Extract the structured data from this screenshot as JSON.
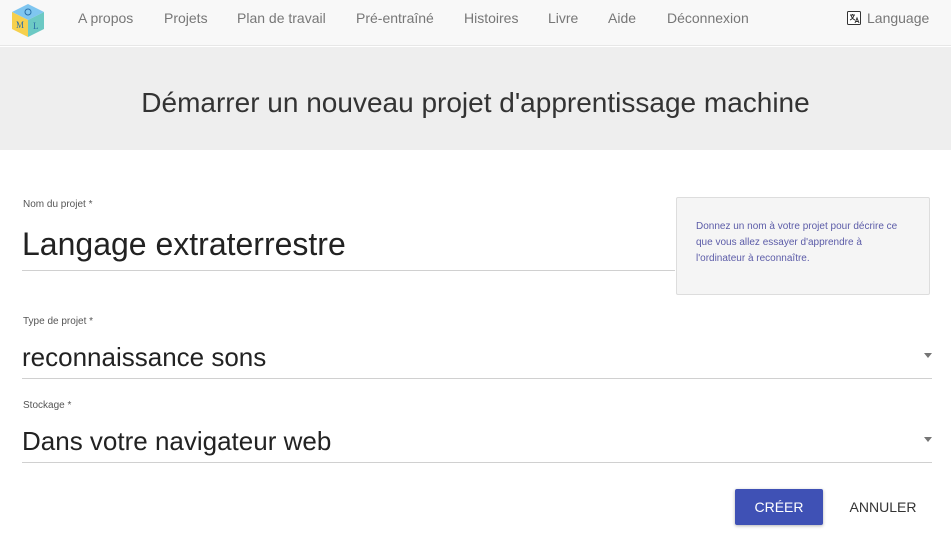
{
  "nav": {
    "items": [
      "A propos",
      "Projets",
      "Plan de travail",
      "Pré-entraîné",
      "Histoires",
      "Livre",
      "Aide",
      "Déconnexion"
    ],
    "language_label": "Language",
    "logo_letters": [
      "M",
      "L"
    ]
  },
  "page": {
    "title": "Démarrer un nouveau projet d'apprentissage machine"
  },
  "form": {
    "project_name": {
      "label": "Nom du projet *",
      "value": "Langage extraterrestre"
    },
    "project_type": {
      "label": "Type de projet *",
      "value": "reconnaissance sons"
    },
    "storage": {
      "label": "Stockage *",
      "value": "Dans votre navigateur web"
    },
    "help_text": "Donnez un nom à votre projet pour décrire ce que vous allez essayer d'apprendre à l'ordinateur à reconnaître."
  },
  "actions": {
    "create_label": "CRÉER",
    "cancel_label": "ANNULER"
  },
  "colors": {
    "primary": "#3f51b5",
    "help_text": "#5c5ca8",
    "hero_bg": "#eeeeee"
  }
}
